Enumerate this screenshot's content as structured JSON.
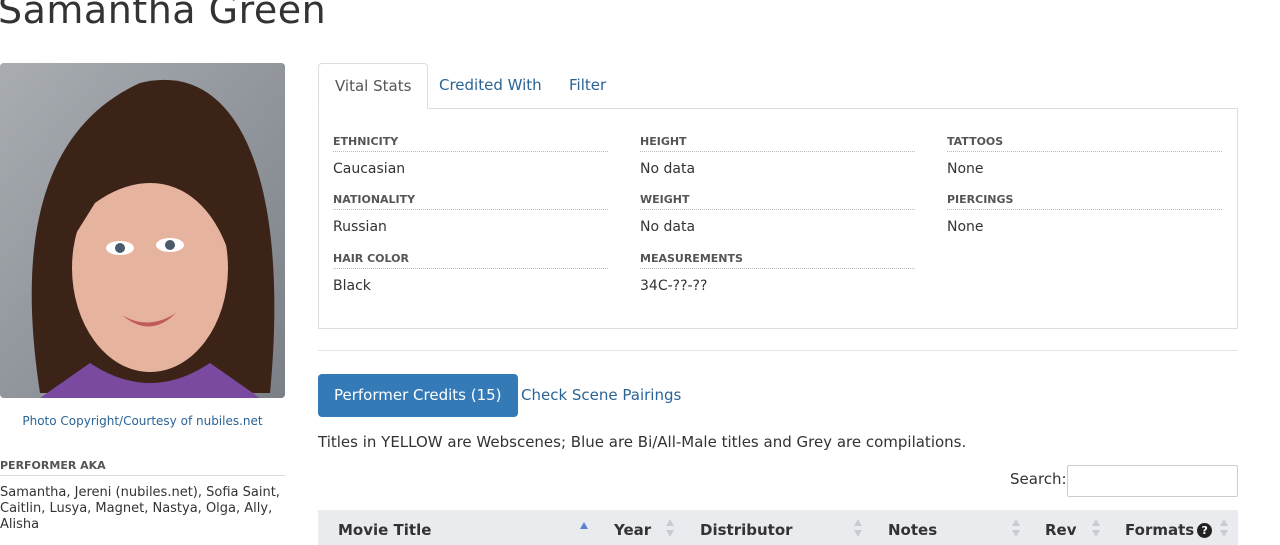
{
  "performer": {
    "name": "Samantha Green",
    "photo_credit": "Photo Copyright/Courtesy of nubiles.net",
    "aka_heading": "PERFORMER AKA",
    "aka": "Samantha, Jereni (nubiles.net), Sofia Saint, Caitlin, Lusya, Magnet, Nastya, Olga, Ally, Alisha"
  },
  "tabs": [
    {
      "label": "Vital Stats",
      "active": true
    },
    {
      "label": "Credited With",
      "active": false
    },
    {
      "label": "Filter",
      "active": false
    }
  ],
  "vital_stats": {
    "ethnicity": {
      "label": "ETHNICITY",
      "value": "Caucasian"
    },
    "nationality": {
      "label": "NATIONALITY",
      "value": "Russian"
    },
    "hair_color": {
      "label": "HAIR COLOR",
      "value": "Black"
    },
    "height": {
      "label": "HEIGHT",
      "value": "No data"
    },
    "weight": {
      "label": "WEIGHT",
      "value": "No data"
    },
    "measurements": {
      "label": "MEASUREMENTS",
      "value": "34C-??-??"
    },
    "tattoos": {
      "label": "TATTOOS",
      "value": "None"
    },
    "piercings": {
      "label": "PIERCINGS",
      "value": "None"
    }
  },
  "credits": {
    "performer_credits_label": "Performer Credits (15)",
    "scene_pairings_label": "Check Scene Pairings",
    "note": "Titles in YELLOW are Webscenes; Blue are Bi/All-Male titles and Grey are compilations."
  },
  "search": {
    "label": "Search:",
    "value": ""
  },
  "table": {
    "columns": [
      "Movie Title",
      "Year",
      "Distributor",
      "Notes",
      "Rev",
      "Formats"
    ],
    "sorted_column": "Movie Title"
  },
  "colors": {
    "link": "#2a6496",
    "primary": "#337ab7",
    "header_bg": "#e9ebee"
  },
  "icons": {
    "formats_help": "question-circle-icon",
    "sort": "sort-both-icon",
    "sort_asc": "sort-asc-icon"
  }
}
